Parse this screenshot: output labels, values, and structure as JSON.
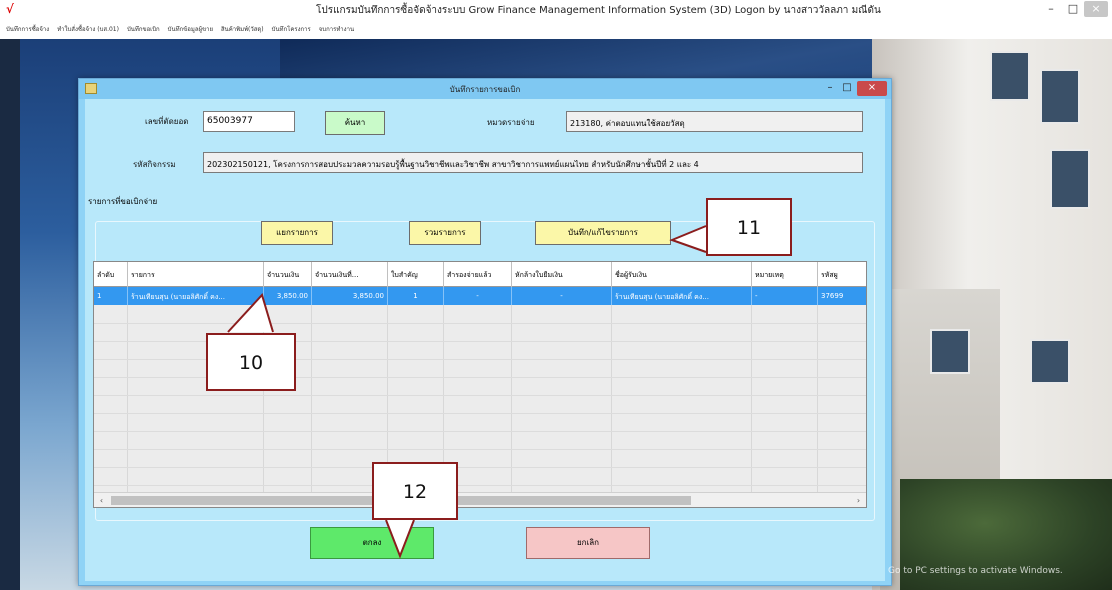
{
  "app": {
    "logo": "√",
    "title": "โปรแกรมบันทึกการซื้อจัดจ้างระบบ  Grow Finance Management Information System (3D) Logon by นางสาววัลลภา  มณีดัน",
    "controls": {
      "minimize": "–",
      "maximize": "□",
      "close": "×"
    }
  },
  "menu": {
    "items": [
      "บันทึกการซื้อจ้าง",
      "ทำใบสั่งซื้อจ้าง (บส.01)",
      "บันทึกขอเบิก",
      "บันทึกข้อมูลผู้ขาย",
      "สินค้าพิมพ์(วัสดุ)",
      "บันทึกโครงการ",
      "จบการทำงาน"
    ]
  },
  "dialog": {
    "title": "บันทึกรายการขอเบิก",
    "controls": {
      "minimize": "–",
      "maximize": "□",
      "close": "×"
    },
    "budget_no_label": "เลขที่ตัดยอด",
    "budget_no_value": "65003977",
    "search_button": "ค้นหา",
    "expense_category_label": "หมวดรายจ่าย",
    "expense_category_value": "213180, ค่าตอบแทนใช้สอยวัสดุ",
    "activity_code_label": "รหัสกิจกรรม",
    "activity_code_value": "202302150121, โครงการการสอบประมวลความรอบรู้พื้นฐานวิชาชีพและวิชาชีพ สาขาวิชาการแพทย์แผนไทย สำหรับนักศึกษาชั้นปีที่ 2 และ 4",
    "group_title": "รายการที่ขอเบิกจ่าย",
    "split_button": "แยกรายการ",
    "merge_button": "รวมรายการ",
    "save_edit_button": "บันทึก/แก้ไขรายการ",
    "ok_button": "ตกลง",
    "cancel_button": "ยกเลิก"
  },
  "grid": {
    "headers": [
      "ลำดับ",
      "รายการ",
      "จำนวนเงิน",
      "จำนวนเงินที่...",
      "ใบสำคัญ",
      "สำรองจ่ายแล้ว",
      "หักล้างใบยืมเงิน",
      "ชื่อผู้รับเงิน",
      "หมายเหตุ",
      "รหัสผู"
    ],
    "rows": [
      [
        "1",
        "ร้านเทียนสุน (นายอลิศักดิ์ คง...",
        "3,850.00",
        "3,850.00",
        "1",
        "-",
        "-",
        "ร้านเทียนสุน (นายอลิศักดิ์ คง...",
        "-",
        "37699"
      ]
    ],
    "scroll_left": "‹",
    "scroll_right": "›"
  },
  "callouts": {
    "c10": "10",
    "c11": "11",
    "c12": "12"
  },
  "watermark": "Go to PC settings to activate Windows."
}
